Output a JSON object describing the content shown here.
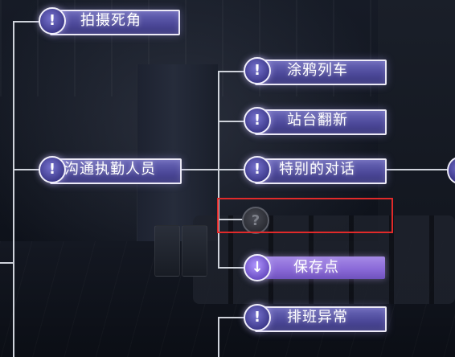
{
  "nodes": {
    "n1": {
      "label": "拍摄死角",
      "icon": "exclamation-icon"
    },
    "n2": {
      "label": "沟通执勤人员",
      "icon": "exclamation-icon"
    },
    "n3": {
      "label": "涂鸦列车",
      "icon": "exclamation-icon"
    },
    "n4": {
      "label": "站台翻新",
      "icon": "exclamation-icon"
    },
    "n5": {
      "label": "特别的对话",
      "icon": "exclamation-icon"
    },
    "n6": {
      "label": "",
      "icon": "question-mark-icon",
      "locked": true
    },
    "n7": {
      "label": "保存点",
      "icon": "save-folder-icon"
    },
    "n8": {
      "label": "排班异常",
      "icon": "exclamation-icon"
    }
  },
  "glyphs": {
    "exclamation": "!",
    "question": "?",
    "save": "↓"
  },
  "colors": {
    "node_fill": "#4d499a",
    "save_fill": "#8b6ad8",
    "highlight": "#e12a2a"
  }
}
